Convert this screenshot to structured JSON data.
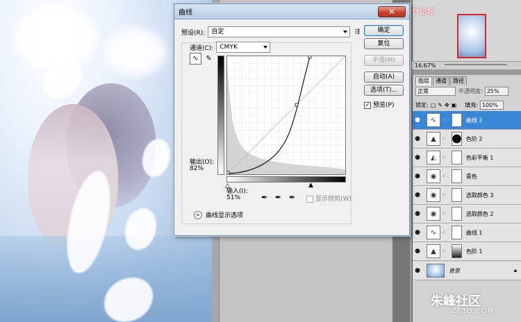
{
  "dialog": {
    "title": "曲线",
    "preset_label": "预设(R):",
    "preset_value": "自定",
    "channel_label": "通道(C):",
    "channel_value": "CMYK",
    "output_label": "输出(O):",
    "output_value": "82%",
    "input_label": "输入(I):",
    "input_value": "51%",
    "show_clipping_label": "显示修剪(W)",
    "expand_label": "曲线显示选项",
    "buttons": {
      "ok": "确定",
      "reset": "复位",
      "smooth": "平滑(M)",
      "auto": "自动(A)",
      "options": "选项(T)...",
      "preview": "预览(P)"
    }
  },
  "navigator": {
    "zoom": "16.67%",
    "watermark": "思缘设计论坛"
  },
  "layers_panel": {
    "tabs": [
      "图层",
      "通道",
      "路径"
    ],
    "blend_mode": "正常",
    "opacity_label": "不透明度:",
    "opacity_value": "25%",
    "lock_label": "锁定:",
    "fill_label": "填充:",
    "fill_value": "100%",
    "layers": [
      {
        "name": "曲线 2",
        "type": "curves",
        "selected": true
      },
      {
        "name": "色阶 2",
        "type": "levels",
        "mask": "dark"
      },
      {
        "name": "色彩平衡 1",
        "type": "balance"
      },
      {
        "name": "青色",
        "type": "fill"
      },
      {
        "name": "选取颜色 3",
        "type": "selective"
      },
      {
        "name": "选取颜色 2",
        "type": "selective"
      },
      {
        "name": "曲线 1",
        "type": "curves"
      },
      {
        "name": "色阶 1",
        "type": "levels",
        "mask": "grad"
      },
      {
        "name": "背景",
        "type": "background"
      }
    ]
  },
  "watermark": {
    "brand": "朱峰社区",
    "url": "ZF3D.COM"
  },
  "colors": {
    "accent": "#3a87d8",
    "close": "#c8452d"
  }
}
